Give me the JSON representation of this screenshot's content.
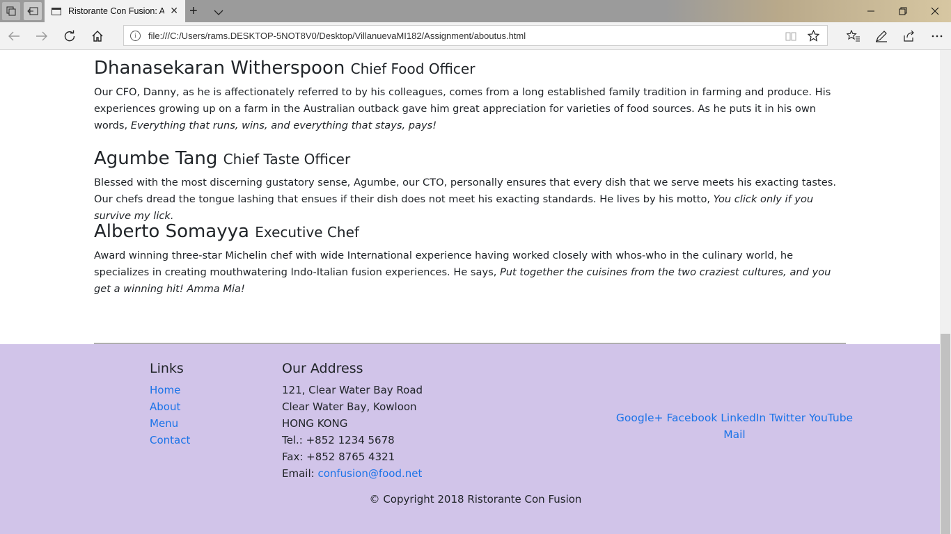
{
  "browser": {
    "tab_title": "Ristorante Con Fusion: About Us",
    "url": "file:///C:/Users/rams.DESKTOP-5NOT8V0/Desktop/VillanuevaMI182/Assignment/aboutus.html",
    "info_glyph": "i"
  },
  "people": [
    {
      "name": "Dhanasekaran Witherspoon",
      "role": "Chief Food Officer",
      "bio": "Our CFO, Danny, as he is affectionately referred to by his colleagues, comes from a long established family tradition in farming and produce. His experiences growing up on a farm in the Australian outback gave him great appreciation for varieties of food sources. As he puts it in his own words, ",
      "quote": "Everything that runs, wins, and everything that stays, pays!"
    },
    {
      "name": "Agumbe Tang",
      "role": "Chief Taste Officer",
      "bio": "Blessed with the most discerning gustatory sense, Agumbe, our CTO, personally ensures that every dish that we serve meets his exacting tastes. Our chefs dread the tongue lashing that ensues if their dish does not meet his exacting standards. He lives by his motto, ",
      "quote": "You click only if you survive my lick."
    },
    {
      "name": "Alberto Somayya",
      "role": "Executive Chef",
      "bio": "Award winning three-star Michelin chef with wide International experience having worked closely with whos-who in the culinary world, he specializes in creating mouthwatering Indo-Italian fusion experiences. He says, ",
      "quote": "Put together the cuisines from the two craziest cultures, and you get a winning hit! Amma Mia!"
    }
  ],
  "footer": {
    "links_title": "Links",
    "links": [
      "Home",
      "About",
      "Menu",
      "Contact"
    ],
    "address_title": "Our Address",
    "address_lines": [
      "121, Clear Water Bay Road",
      "Clear Water Bay, Kowloon",
      "HONG KONG",
      "Tel.: +852 1234 5678",
      "Fax: +852 8765 4321"
    ],
    "email_label": "Email: ",
    "email": "confusion@food.net",
    "social": [
      "Google+",
      "Facebook",
      "LinkedIn",
      "Twitter",
      "YouTube",
      "Mail"
    ],
    "copyright": "© Copyright 2018 Ristorante Con Fusion"
  },
  "colors": {
    "footer_bg": "#d1c4e9",
    "link": "#1a73e8"
  }
}
